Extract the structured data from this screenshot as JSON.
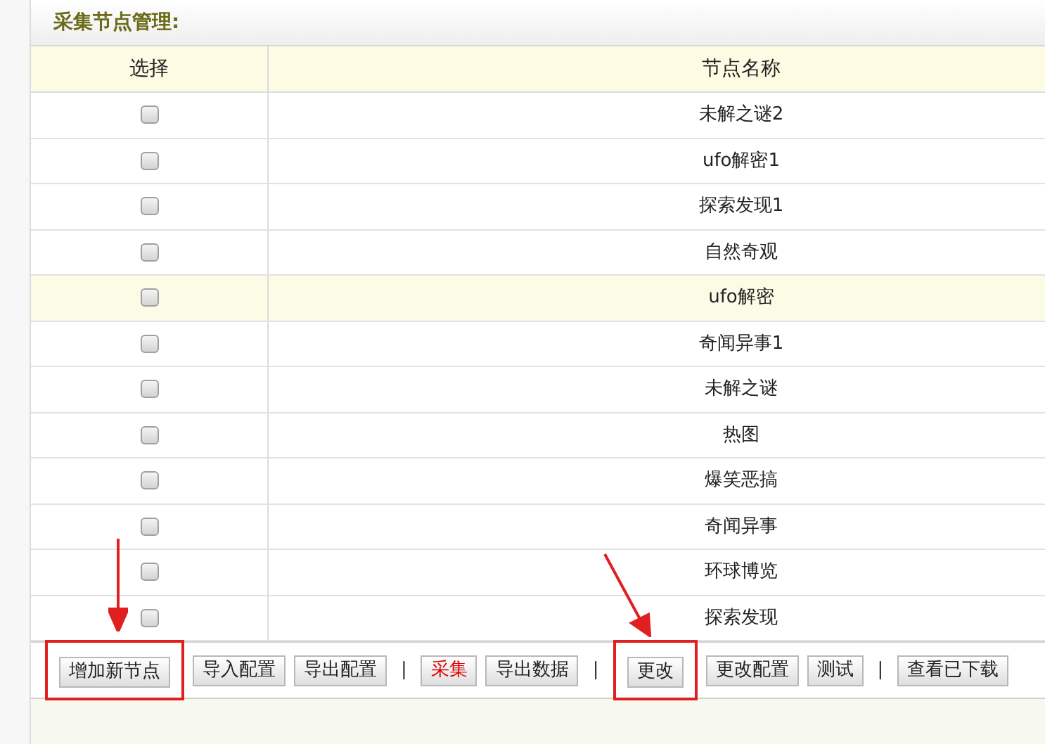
{
  "title": "采集节点管理:",
  "table": {
    "columns": [
      "选择",
      "节点名称"
    ],
    "rows": [
      {
        "name": "未解之谜2",
        "checked": false,
        "highlighted": false
      },
      {
        "name": "ufo解密1",
        "checked": false,
        "highlighted": false
      },
      {
        "name": "探索发现1",
        "checked": false,
        "highlighted": false
      },
      {
        "name": "自然奇观",
        "checked": false,
        "highlighted": false
      },
      {
        "name": "ufo解密",
        "checked": false,
        "highlighted": true
      },
      {
        "name": "奇闻异事1",
        "checked": false,
        "highlighted": false
      },
      {
        "name": "未解之谜",
        "checked": false,
        "highlighted": false
      },
      {
        "name": "热图",
        "checked": false,
        "highlighted": false
      },
      {
        "name": "爆笑恶搞",
        "checked": false,
        "highlighted": false
      },
      {
        "name": "奇闻异事",
        "checked": false,
        "highlighted": false
      },
      {
        "name": "环球博览",
        "checked": false,
        "highlighted": false
      },
      {
        "name": "探索发现",
        "checked": false,
        "highlighted": false
      }
    ]
  },
  "toolbar": [
    {
      "kind": "button",
      "label": "增加新节点",
      "alert": false,
      "highlighted": true,
      "arrow": true
    },
    {
      "kind": "button",
      "label": "导入配置",
      "alert": false,
      "highlighted": false
    },
    {
      "kind": "button",
      "label": "导出配置",
      "alert": false,
      "highlighted": false
    },
    {
      "kind": "separator",
      "label": "|"
    },
    {
      "kind": "button",
      "label": "采集",
      "alert": true,
      "highlighted": false
    },
    {
      "kind": "button",
      "label": "导出数据",
      "alert": false,
      "highlighted": false
    },
    {
      "kind": "separator",
      "label": "|"
    },
    {
      "kind": "button",
      "label": "更改",
      "alert": false,
      "highlighted": true,
      "arrow": true
    },
    {
      "kind": "button",
      "label": "更改配置",
      "alert": false,
      "highlighted": false
    },
    {
      "kind": "button",
      "label": "测试",
      "alert": false,
      "highlighted": false
    },
    {
      "kind": "separator",
      "label": "|"
    },
    {
      "kind": "button",
      "label": "查看已下载",
      "alert": false,
      "highlighted": false
    }
  ]
}
